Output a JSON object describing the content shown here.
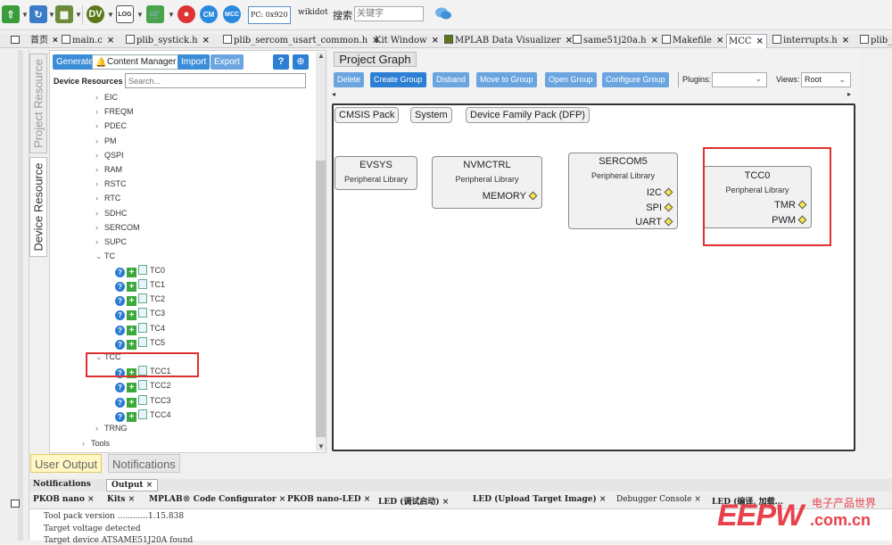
{
  "toolbar": {
    "pc_label": "PC: 0x920",
    "search_site": "wikidot",
    "search_label": "搜索",
    "search_placeholder": "关键字"
  },
  "file_tabs": [
    {
      "label": "首页"
    },
    {
      "label": "main.c"
    },
    {
      "label": "plib_systick.h"
    },
    {
      "label": "plib_sercom_usart_common.h"
    },
    {
      "label": "Kit Window"
    },
    {
      "label": "MPLAB Data Visualizer"
    },
    {
      "label": "same51j20a.h"
    },
    {
      "label": "Makefile"
    },
    {
      "label": "MCC"
    },
    {
      "label": "interrupts.h"
    },
    {
      "label": "plib_"
    }
  ],
  "side_tabs": {
    "project_resource": "Project Resource",
    "device_resource": "Device Resource"
  },
  "device_panel": {
    "generate": "Generate",
    "content_manager": "Content Manager",
    "import": "Import",
    "export": "Export",
    "resources_label": "Device Resources",
    "search_placeholder": "Search...",
    "tree": [
      {
        "label": "EIC",
        "expanded": false
      },
      {
        "label": "FREQM",
        "expanded": false
      },
      {
        "label": "PDEC",
        "expanded": false
      },
      {
        "label": "PM",
        "expanded": false
      },
      {
        "label": "QSPI",
        "expanded": false
      },
      {
        "label": "RAM",
        "expanded": false
      },
      {
        "label": "RSTC",
        "expanded": false
      },
      {
        "label": "RTC",
        "expanded": false
      },
      {
        "label": "SDHC",
        "expanded": false
      },
      {
        "label": "SERCOM",
        "expanded": false
      },
      {
        "label": "SUPC",
        "expanded": false
      },
      {
        "label": "TC",
        "expanded": true
      },
      {
        "label": "TC0",
        "leaf": true
      },
      {
        "label": "TC1",
        "leaf": true
      },
      {
        "label": "TC2",
        "leaf": true
      },
      {
        "label": "TC3",
        "leaf": true
      },
      {
        "label": "TC4",
        "leaf": true
      },
      {
        "label": "TC5",
        "leaf": true
      },
      {
        "label": "TCC",
        "expanded": true
      },
      {
        "label": "TCC1",
        "leaf": true
      },
      {
        "label": "TCC2",
        "leaf": true
      },
      {
        "label": "TCC3",
        "leaf": true
      },
      {
        "label": "TCC4",
        "leaf": true
      },
      {
        "label": "TRNG",
        "expanded": false
      },
      {
        "label": "Tools",
        "expanded": false
      }
    ]
  },
  "graph": {
    "title": "Project Graph",
    "buttons": [
      "Delete",
      "Create Group",
      "Disband",
      "Move to Group",
      "Open Group",
      "Configure Group"
    ],
    "plugins_label": "Plugins:",
    "views_label": "Views:",
    "views_value": "Root",
    "packs": [
      "CMSIS Pack",
      "System",
      "Device Family Pack (DFP)"
    ],
    "components": [
      {
        "name": "EVSYS",
        "sub": "Peripheral Library",
        "ports": []
      },
      {
        "name": "NVMCTRL",
        "sub": "Peripheral Library",
        "ports": [
          "MEMORY"
        ]
      },
      {
        "name": "SERCOM5",
        "sub": "Peripheral Library",
        "ports": [
          "I2C",
          "SPI",
          "UART"
        ]
      },
      {
        "name": "TCC0",
        "sub": "Peripheral Library",
        "ports": [
          "TMR",
          "PWM"
        ]
      }
    ]
  },
  "bottom": {
    "user_output": "User Output",
    "notifications": "Notifications",
    "lower_tabs": [
      "Notifications",
      "Output"
    ],
    "output_tabs": [
      "PKOB nano",
      "Kits",
      "MPLAB® Code Configurator",
      "PKOB nano-LED",
      "LED (调试启动)",
      "LED (Upload Target Image)",
      "Debugger Console",
      "LED (编译, 加载..."
    ],
    "console_lines": [
      "Tool pack version ............1.15.838",
      "Target voltage detected",
      "Target device ATSAME51J20A found"
    ]
  },
  "watermark": {
    "brand": "EEPW",
    "domain": ".com.cn",
    "tag": "电子产品世界"
  }
}
